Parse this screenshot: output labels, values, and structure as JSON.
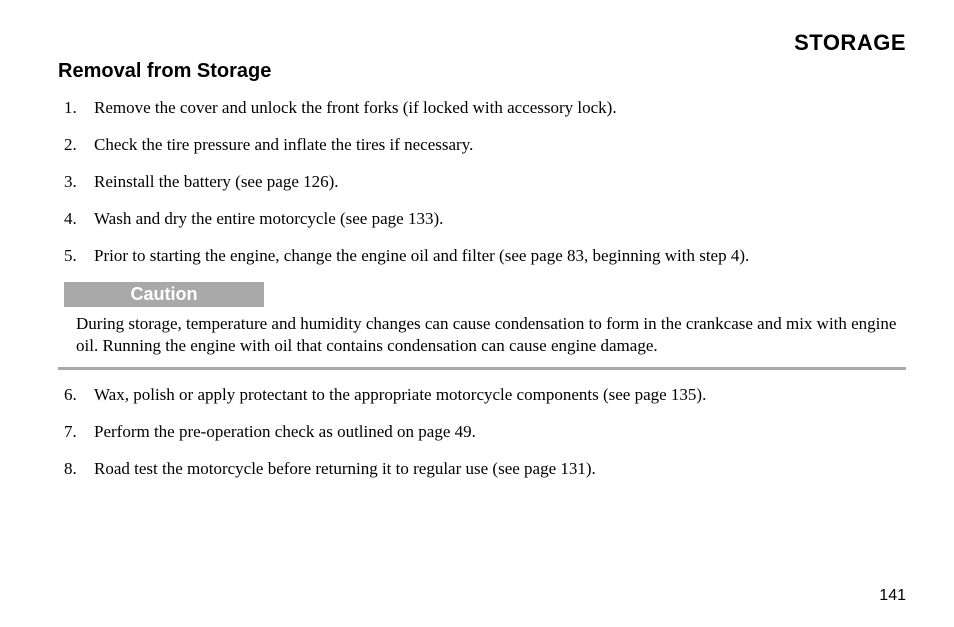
{
  "header": "STORAGE",
  "section_title": "Removal from Storage",
  "steps_before": [
    "Remove the cover and unlock the front forks (if locked with accessory lock).",
    "Check the tire pressure and inflate the tires if necessary.",
    "Reinstall the battery (see page 126).",
    "Wash and dry the entire motorcycle (see page 133).",
    "Prior to starting the engine, change the engine oil and filter (see page 83, beginning with step 4)."
  ],
  "caution": {
    "label": "Caution",
    "text": "During storage, temperature and humidity changes can cause condensation to form in the crankcase and mix with engine oil. Running the engine with oil that contains condensation can cause engine damage."
  },
  "steps_after": [
    "Wax, polish or apply protectant to the appropriate motorcycle components (see page 135).",
    "Perform the pre-operation check as outlined on page 49.",
    "Road test the motorcycle before returning it to regular use (see page 131)."
  ],
  "page_number": "141"
}
